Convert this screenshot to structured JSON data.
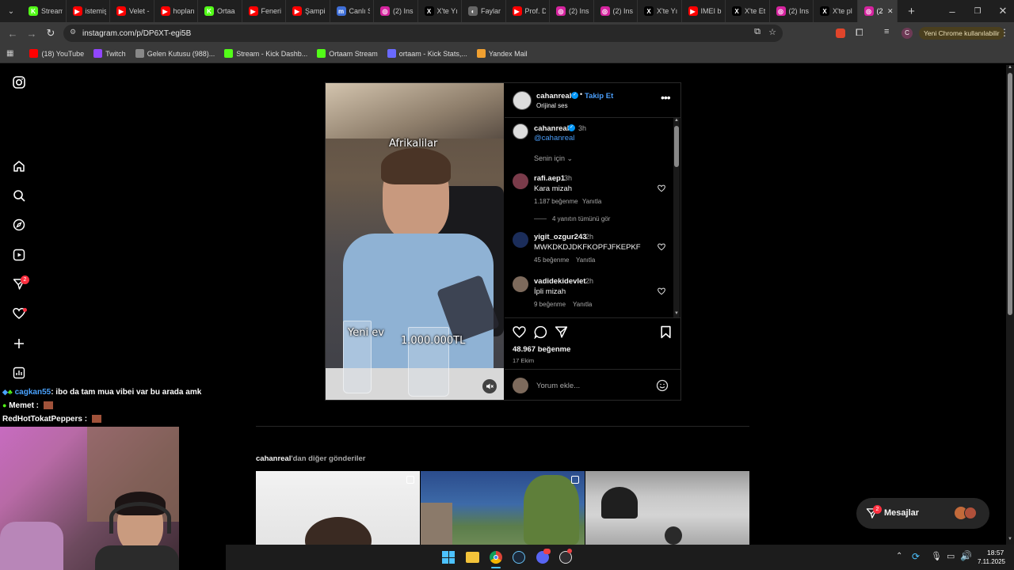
{
  "browser": {
    "tabs": [
      {
        "label": "Stream",
        "color": "#53fc18",
        "glyph": "K"
      },
      {
        "label": "istemiş",
        "color": "#ff0000",
        "glyph": "▶"
      },
      {
        "label": "Velet -",
        "color": "#ff0000",
        "glyph": "▶"
      },
      {
        "label": "hoplan",
        "color": "#ff0000",
        "glyph": "▶"
      },
      {
        "label": "Ortaa",
        "color": "#53fc18",
        "glyph": "K"
      },
      {
        "label": "Feneri",
        "color": "#ff0000",
        "glyph": "▶"
      },
      {
        "label": "Şampi",
        "color": "#ff0000",
        "glyph": "▶"
      },
      {
        "label": "Canlı S",
        "color": "#3f6fd8",
        "glyph": "m"
      },
      {
        "label": "(2) Ins",
        "color": "#d6249f",
        "glyph": "◎"
      },
      {
        "label": "X'te Yı",
        "color": "#000000",
        "glyph": "X"
      },
      {
        "label": "Faylar",
        "color": "#666666",
        "glyph": "◐"
      },
      {
        "label": "Prof. D",
        "color": "#ff0000",
        "glyph": "▶"
      },
      {
        "label": "(2) Ins",
        "color": "#d6249f",
        "glyph": "◎"
      },
      {
        "label": "(2) Ins",
        "color": "#d6249f",
        "glyph": "◎"
      },
      {
        "label": "X'te Yı",
        "color": "#000000",
        "glyph": "X"
      },
      {
        "label": "IMEI b",
        "color": "#ff0000",
        "glyph": "▶"
      },
      {
        "label": "X'te Et",
        "color": "#000000",
        "glyph": "X"
      },
      {
        "label": "(2) Ins",
        "color": "#d6249f",
        "glyph": "◎"
      },
      {
        "label": "X'te pl",
        "color": "#000000",
        "glyph": "X"
      },
      {
        "label": "(2",
        "color": "#d6249f",
        "glyph": "◎",
        "active": true
      }
    ],
    "url": "instagram.com/p/DP6XT-egi5B",
    "update_label": "Yeni Chrome kullanılabilir",
    "profile_initial": "C",
    "bookmarks": [
      {
        "label": "(18) YouTube",
        "color": "#ff0000"
      },
      {
        "label": "Twitch",
        "color": "#9146ff"
      },
      {
        "label": "Gelen Kutusu (988)...",
        "color": "#888888"
      },
      {
        "label": "Stream - Kick Dashb...",
        "color": "#53fc18"
      },
      {
        "label": "Ortaam Stream",
        "color": "#53fc18"
      },
      {
        "label": "ortaam - Kick Stats,...",
        "color": "#6a6aff"
      },
      {
        "label": "Yandex Mail",
        "color": "#f0a030"
      }
    ]
  },
  "rail": {
    "icons": [
      "instagram-logo-icon",
      "home-icon",
      "search-icon",
      "explore-icon",
      "reels-icon",
      "messages-icon",
      "notifications-icon",
      "create-icon",
      "dashboard-icon"
    ],
    "messages_badge": "2"
  },
  "post": {
    "header": {
      "username": "cahanreal",
      "follow": "Takip Et",
      "audio": "Orijinal ses"
    },
    "caption": {
      "username": "cahanreal",
      "time": "3h",
      "mention": "@cahanreal"
    },
    "for_you": "Senin için",
    "comments": [
      {
        "username": "rafi.aep1",
        "time": "3h",
        "text": "Kara mizah",
        "likes": "1.187 beğenme",
        "reply": "Yanıtla",
        "view_replies": "4 yanıtın tümünü gör"
      },
      {
        "username": "yigit_ozgur243",
        "time": "2h",
        "text": "MWKDKDJDKFKOPFJFKEPKF",
        "likes": "45 beğenme",
        "reply": "Yanıtla"
      },
      {
        "username": "vadidekidevlet",
        "time": "2h",
        "text": "İpli mizah",
        "likes": "9 beğenme",
        "reply": "Yanıtla"
      }
    ],
    "likes": "48.967 beğenme",
    "date": "17 Ekim",
    "comment_placeholder": "Yorum ekle...",
    "video_overlay": {
      "top": "Afrikalilar",
      "left": "Yeni ev",
      "right": "1.000.000TL"
    }
  },
  "more_posts": {
    "username": "cahanreal",
    "suffix": "'dan diğer gönderiler"
  },
  "messages_widget": {
    "label": "Mesajlar",
    "badge": "2"
  },
  "stream_chat": [
    {
      "user": "cagkan55",
      "text": ": ibo da tam mua vibei var bu arada amk",
      "color": "#4aa3ff"
    },
    {
      "user": "Memet",
      "text": " :",
      "color": "#ffffff"
    },
    {
      "user": "RedHotTokatPeppers",
      "text": " :",
      "color": "#ffffff"
    }
  ],
  "taskbar": {
    "time": "18:57",
    "date": "7.11.2025"
  }
}
